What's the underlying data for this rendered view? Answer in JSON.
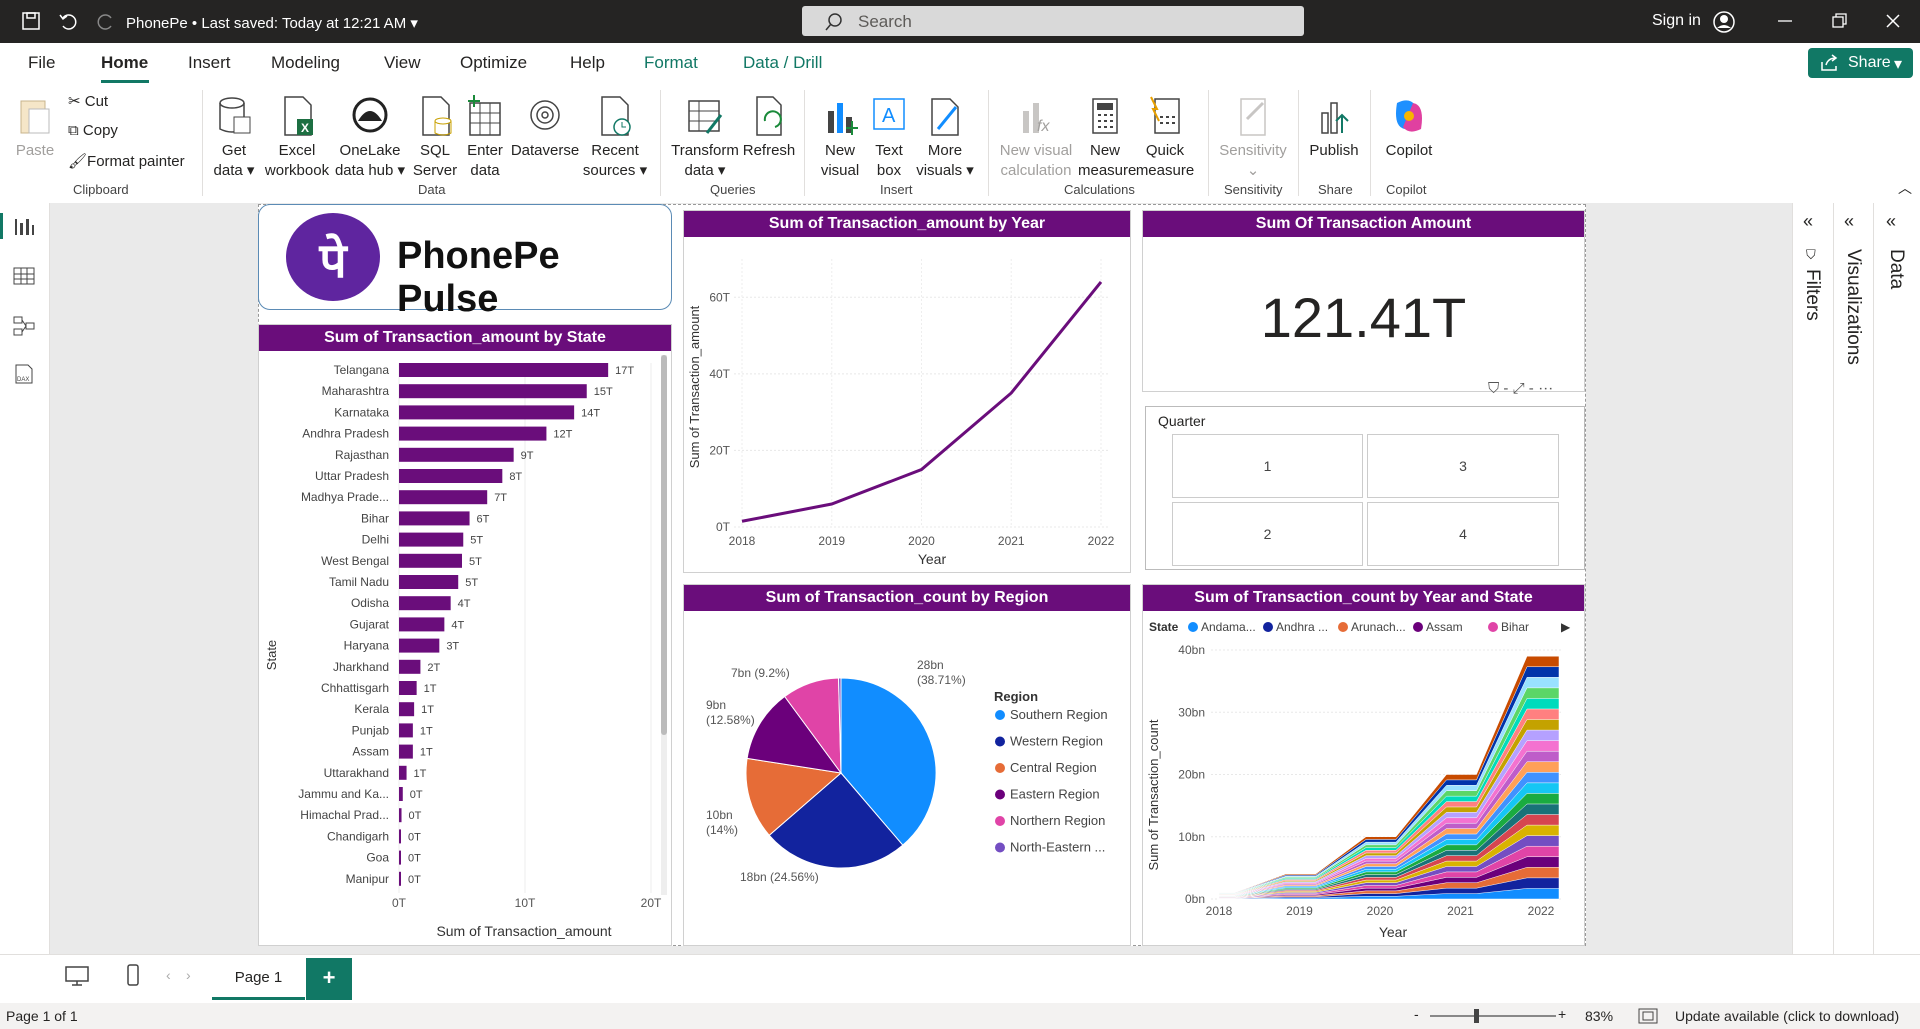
{
  "app": {
    "title": "PhonePe",
    "save_status": "Last saved: Today at 12:21 AM",
    "search_placeholder": "Search",
    "sign_in": "Sign in"
  },
  "menu": [
    {
      "label": "File"
    },
    {
      "label": "Home"
    },
    {
      "label": "Insert"
    },
    {
      "label": "Modeling"
    },
    {
      "label": "View"
    },
    {
      "label": "Optimize"
    },
    {
      "label": "Help"
    },
    {
      "label": "Format"
    },
    {
      "label": "Data / Drill"
    }
  ],
  "share": "Share",
  "ribbon": {
    "clipboard": {
      "paste": "Paste",
      "cut": "Cut",
      "copy": "Copy",
      "format_painter": "Format painter",
      "group": "Clipboard"
    },
    "data": {
      "get_data": "Get data",
      "excel": "Excel workbook",
      "onelake": "OneLake data hub",
      "sql": "SQL Server",
      "enter": "Enter data",
      "dataverse": "Dataverse",
      "recent": "Recent sources",
      "group": "Data"
    },
    "queries": {
      "transform": "Transform data",
      "refresh": "Refresh",
      "group": "Queries"
    },
    "insert": {
      "new_visual": "New visual",
      "text_box": "Text box",
      "more_visuals": "More visuals",
      "group": "Insert"
    },
    "calculations": {
      "new_visual_calc": "New visual calculation",
      "new_measure": "New measure",
      "quick_measure": "Quick measure",
      "group": "Calculations"
    },
    "sensitivity": {
      "sensitivity": "Sensitivity",
      "group": "Sensitivity"
    },
    "share": {
      "publish": "Publish",
      "group": "Share"
    },
    "copilot": {
      "copilot": "Copilot",
      "group": "Copilot"
    }
  },
  "logo": {
    "text": "PhonePe Pulse",
    "glyph": "पे"
  },
  "bar_visual": {
    "title": "Sum of Transaction_amount by State",
    "ylabel": "State",
    "xlabel": "Sum of Transaction_amount"
  },
  "line_visual": {
    "title": "Sum of Transaction_amount by Year",
    "ylabel": "Sum of Transaction_amount",
    "xlabel": "Year"
  },
  "card": {
    "title": "Sum Of Transaction Amount",
    "value": "121.41T"
  },
  "slicer": {
    "title": "Quarter",
    "items": [
      "1",
      "3",
      "2",
      "4"
    ]
  },
  "pie_visual": {
    "title": "Sum of Transaction_count by Region",
    "legend_title": "Region",
    "labels": [
      "28bn (38.71%)",
      "18bn (24.56%)",
      "10bn (14%)",
      "9bn (12.58%)",
      "7bn (9.2%)"
    ]
  },
  "area_visual": {
    "title": "Sum of Transaction_count by Year and State",
    "legend_title": "State",
    "legend": [
      "Andama...",
      "Andhra ...",
      "Arunach...",
      "Assam",
      "Bihar"
    ],
    "ylabel": "Sum of Transaction_count",
    "xlabel": "Year"
  },
  "colors": {
    "purple": "#6a0d7b",
    "pie": [
      "#118dff",
      "#12239e",
      "#e66c37",
      "#6b007b",
      "#e044a7",
      "#744ec2"
    ],
    "area": [
      "#118dff",
      "#12239e",
      "#e66c37",
      "#6b007b",
      "#e044a7",
      "#744ec2",
      "#d9b300",
      "#d64550",
      "#197278",
      "#1aab40",
      "#15c6f4",
      "#4092ff",
      "#ffa058",
      "#be5dc9",
      "#f472d0",
      "#b5a1ff",
      "#c4a200",
      "#ff8080",
      "#00dbbc",
      "#5bd667",
      "#99e1ff",
      "#0033aa",
      "#c84b00"
    ]
  },
  "pane_labels": {
    "filters": "Filters",
    "visualizations": "Visualizations",
    "data": "Data"
  },
  "page_tab": "Page 1",
  "status": {
    "page": "Page 1 of 1",
    "zoom": "83%",
    "update": "Update available (click to download)"
  },
  "chart_data": [
    {
      "type": "bar",
      "title": "Sum of Transaction_amount by State",
      "xlabel": "Sum of Transaction_amount",
      "ylabel": "State",
      "categories": [
        "Telangana",
        "Maharashtra",
        "Karnataka",
        "Andhra Pradesh",
        "Rajasthan",
        "Uttar Pradesh",
        "Madhya Prade...",
        "Bihar",
        "Delhi",
        "West Bengal",
        "Tamil Nadu",
        "Odisha",
        "Gujarat",
        "Haryana",
        "Jharkhand",
        "Chhattisgarh",
        "Kerala",
        "Punjab",
        "Assam",
        "Uttarakhand",
        "Jammu and Ka...",
        "Himachal Prad...",
        "Chandigarh",
        "Goa",
        "Manipur"
      ],
      "values": [
        16.6,
        14.9,
        13.9,
        11.7,
        9.1,
        8.2,
        7.0,
        5.6,
        5.1,
        5.0,
        4.7,
        4.1,
        3.6,
        3.2,
        1.7,
        1.4,
        1.2,
        1.1,
        1.1,
        0.6,
        0.3,
        0.2,
        0.1,
        0.1,
        0.1
      ],
      "data_labels": [
        "17T",
        "15T",
        "14T",
        "12T",
        "9T",
        "8T",
        "7T",
        "6T",
        "5T",
        "5T",
        "5T",
        "4T",
        "4T",
        "3T",
        "2T",
        "1T",
        "1T",
        "1T",
        "1T",
        "1T",
        "0T",
        "0T",
        "0T",
        "0T",
        "0T"
      ],
      "xticks": [
        "0T",
        "10T",
        "20T"
      ],
      "xlim": [
        0,
        20
      ]
    },
    {
      "type": "line",
      "title": "Sum of Transaction_amount by Year",
      "xlabel": "Year",
      "ylabel": "Sum of Transaction_amount",
      "x": [
        2018,
        2019,
        2020,
        2021,
        2022
      ],
      "values": [
        1.5,
        6,
        15,
        35,
        64
      ],
      "yticks": [
        "0T",
        "20T",
        "40T",
        "60T"
      ],
      "ylim": [
        0,
        70
      ]
    },
    {
      "type": "pie",
      "title": "Sum of Transaction_count by Region",
      "legend": [
        "Southern Region",
        "Western Region",
        "Central Region",
        "Eastern Region",
        "Northern Region",
        "North-Eastern ..."
      ],
      "values": [
        28,
        18,
        10,
        9,
        7,
        0.3
      ],
      "percent": [
        38.71,
        24.56,
        14,
        12.58,
        9.2,
        0.4
      ]
    },
    {
      "type": "area",
      "title": "Sum of Transaction_count by Year and State",
      "xlabel": "Year",
      "ylabel": "Sum of Transaction_count",
      "x": [
        2018,
        2019,
        2020,
        2021,
        2022
      ],
      "total": [
        1,
        4,
        10,
        20,
        39
      ],
      "yticks": [
        "0bn",
        "10bn",
        "20bn",
        "30bn",
        "40bn"
      ],
      "ylim": [
        0,
        40
      ]
    }
  ]
}
